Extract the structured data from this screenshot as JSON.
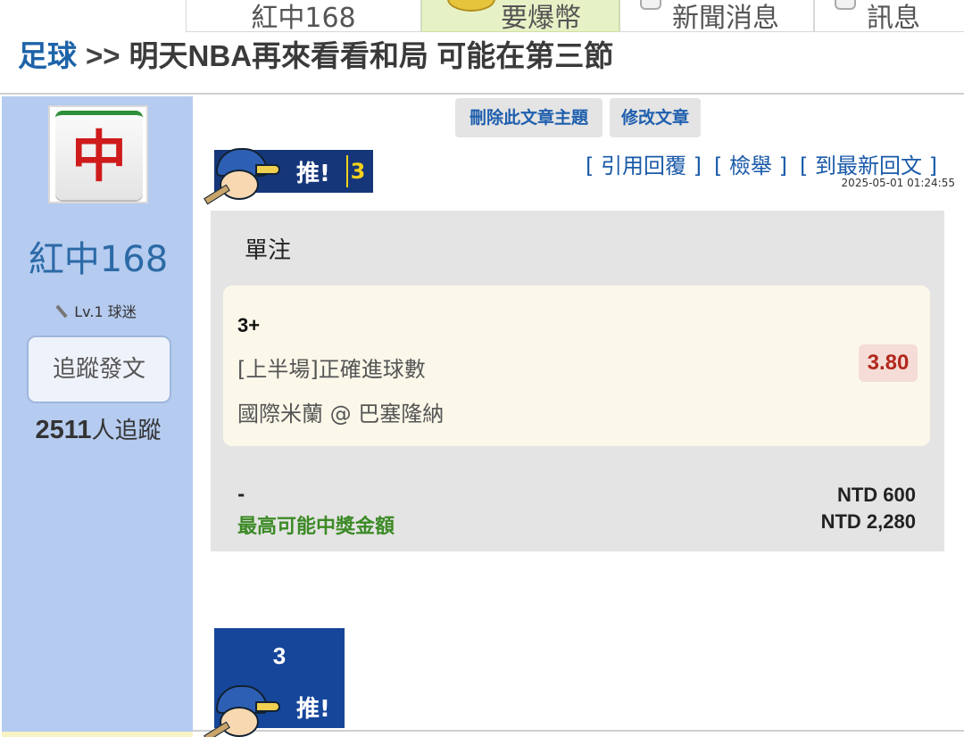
{
  "tabs": [
    {
      "label": "紅中168"
    },
    {
      "label": "要爆幣",
      "icon": "coin-icon"
    },
    {
      "label": "新聞消息"
    },
    {
      "label": "訊息"
    }
  ],
  "breadcrumb": {
    "category": "足球",
    "separator": ">>",
    "title": "明天NBA再來看看和局 可能在第三節"
  },
  "user": {
    "avatar_glyph": "中",
    "name": "紅中168",
    "level": "Lv.1 球迷",
    "follow_label": "追蹤發文",
    "follower_count": "2511",
    "follower_suffix": "人追蹤"
  },
  "actions": {
    "delete_label": "刪除此文章主題",
    "edit_label": "修改文章",
    "quote_reply": "[ 引用回覆 ]",
    "report": "[ 檢舉 ]",
    "latest_reply": "[ 到最新回文 ]"
  },
  "post": {
    "push_label": "推!",
    "push_count": "3",
    "timestamp": "2025-05-01 01:24:55"
  },
  "bet": {
    "type": "單注",
    "selection": "3+",
    "market": "[上半場]正確進球數",
    "match": "國際米蘭 @ 巴塞隆納",
    "odds": "3.80",
    "dash": "-",
    "stake": "NTD 600",
    "max_payout_label": "最高可能中獎金額",
    "max_payout": "NTD 2,280"
  },
  "push_box": {
    "count": "3",
    "label": "推!"
  },
  "colors": {
    "sidebar": "#b5cbef",
    "link": "#1a5aa8",
    "odds_text": "#b2281e",
    "payout_label": "#3c8a26",
    "push_badge": "#16367a"
  }
}
